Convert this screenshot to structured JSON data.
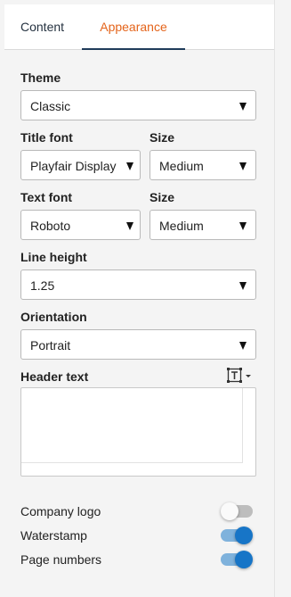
{
  "tabs": {
    "content": "Content",
    "appearance": "Appearance",
    "active": "Appearance"
  },
  "theme": {
    "label": "Theme",
    "value": "Classic"
  },
  "title_font": {
    "label": "Title font",
    "value": "Playfair Display"
  },
  "title_size": {
    "label": "Size",
    "value": "Medium"
  },
  "text_font": {
    "label": "Text font",
    "value": "Roboto"
  },
  "text_size": {
    "label": "Size",
    "value": "Medium"
  },
  "line_height": {
    "label": "Line height",
    "value": "1.25"
  },
  "orientation": {
    "label": "Orientation",
    "value": "Portrait"
  },
  "header_text": {
    "label": "Header text",
    "value": "",
    "insert_icon": "insert-text-field-icon"
  },
  "toggles": {
    "company_logo": {
      "label": "Company logo",
      "on": false
    },
    "waterstamp": {
      "label": "Waterstamp",
      "on": true
    },
    "page_numbers": {
      "label": "Page numbers",
      "on": true
    }
  },
  "colors": {
    "accent": "#e4641b",
    "toggle_on": "#1775c7",
    "tab_underline": "#1f3c5a"
  }
}
